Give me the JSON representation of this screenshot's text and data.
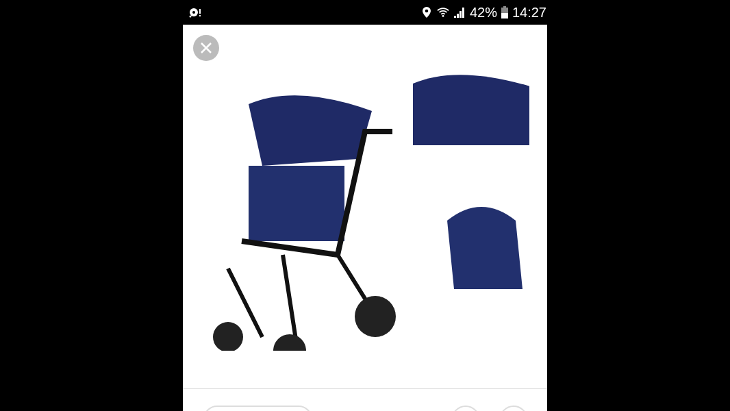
{
  "status_bar": {
    "battery": "42%",
    "time": "14:27"
  }
}
